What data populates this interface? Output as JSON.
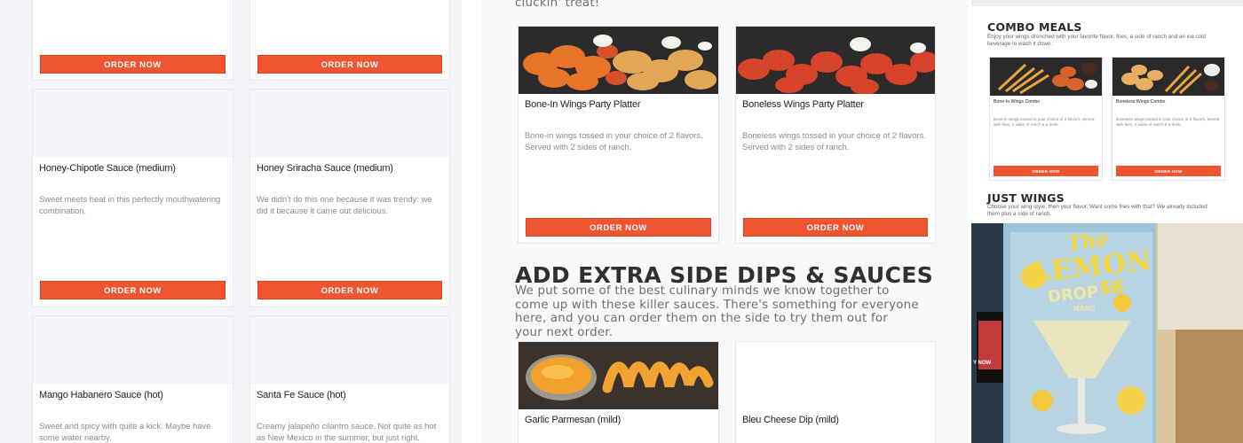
{
  "colors": {
    "accent": "#ee5530",
    "page_bg": "#f4f5f8"
  },
  "order_button_label": "ORDER NOW",
  "left_column": {
    "cards": [
      {
        "title": "",
        "description": ""
      },
      {
        "title": "",
        "description": ""
      },
      {
        "title": "Honey-Chipotle Sauce (medium)",
        "description": "Sweet meets heat in this perfectly mouthwatering combination."
      },
      {
        "title": "Honey Sriracha Sauce (medium)",
        "description": "We didn't do this one because it was trendy: we did it because it came out delicious."
      },
      {
        "title": "Mango Habanero Sauce (hot)",
        "description": "Sweet and spicy with quite a kick. Maybe have some water nearby."
      },
      {
        "title": "Santa Fe Sauce (hot)",
        "description": "Creamy jalapeño cilantro sauce. Not quite as hot as New Mexico in the summer, but just right."
      }
    ]
  },
  "middle_column": {
    "intro_tail": "cluckin' treat!",
    "platters": [
      {
        "title": "Bone-In Wings Party Platter",
        "description": "Bone-in wings tossed in your choice of 2 flavors. Served with 2 sides of ranch.",
        "image": "bone-in-wings-photo"
      },
      {
        "title": "Boneless Wings Party Platter",
        "description": "Boneless wings tossed in your choice of 2 flavors. Served with 2 sides of ranch.",
        "image": "boneless-wings-photo"
      }
    ],
    "dips_heading": "ADD EXTRA SIDE DIPS & SAUCES",
    "dips_intro": "We put some of the best culinary minds we know together to come up with these killer sauces. There's something for everyone here, and you can order them on the side to try them out for your next order.",
    "dips": [
      {
        "title": "Garlic Parmesan (mild)",
        "image": "garlic-parmesan-photo"
      },
      {
        "title": "Bleu Cheese Dip (mild)",
        "image": ""
      }
    ]
  },
  "right_panel": {
    "combo": {
      "heading": "COMBO MEALS",
      "description": "Enjoy your wings drenched with your favorite flavor, fries, a side of ranch and an ice cold beverage to wash it down.",
      "items": [
        {
          "title": "Bone-In Wings Combo",
          "description": "Bone-in wings tossed in your choice of 2 flavors, served with fries, 2 sides of ranch & a drink."
        },
        {
          "title": "Boneless Wings Combo",
          "description": "Boneless wings tossed in your choice of 2 flavors, served with fries, 2 sides of ranch & a drink."
        }
      ]
    },
    "just_wings": {
      "heading": "JUST WINGS",
      "description": "Choose your wing style, then your flavor. Want some fries with that? We already included them plus a side of ranch."
    },
    "promo": {
      "line1": "The",
      "line2": "LEMON",
      "line3": "DROP",
      "price": "$6",
      "sub": "MARG",
      "edge_text": "Y NOW"
    }
  }
}
